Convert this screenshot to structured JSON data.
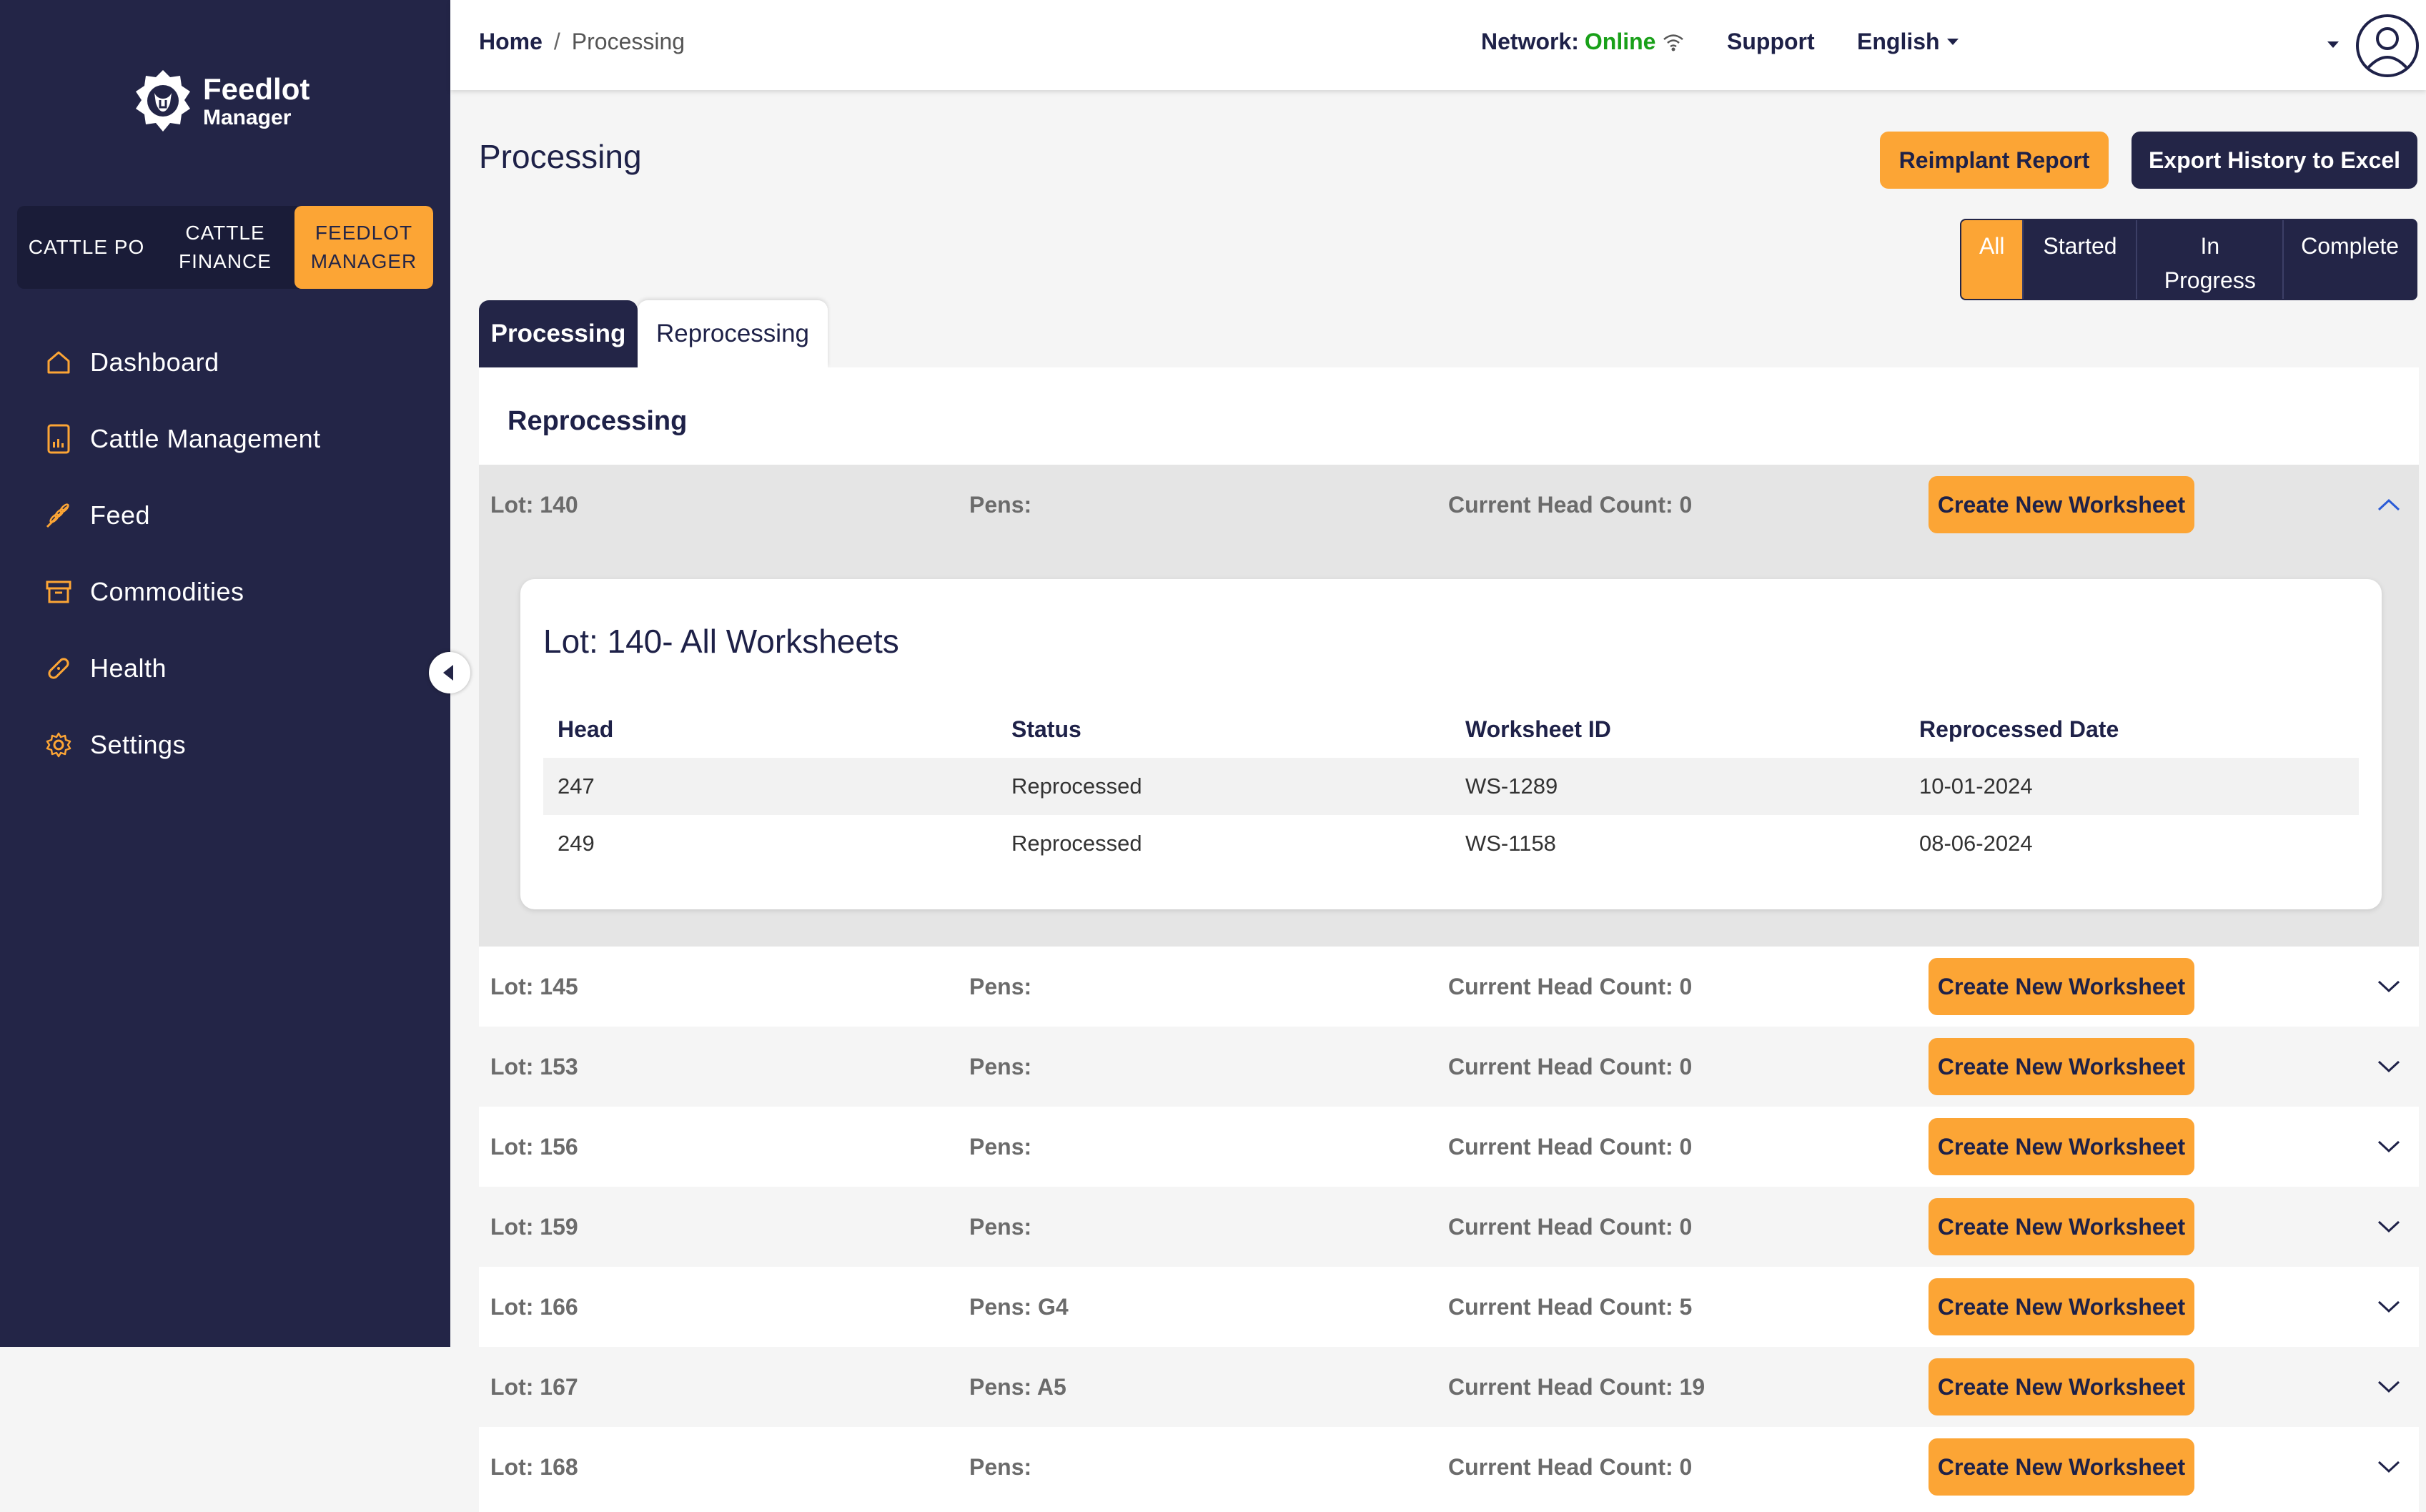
{
  "app": {
    "logo_line1": "Feedlot",
    "logo_line2": "Manager",
    "switcher": [
      {
        "label": "CATTLE PO"
      },
      {
        "label": "CATTLE\nFINANCE"
      },
      {
        "label": "FEEDLOT\nMANAGER"
      }
    ]
  },
  "sidebar": {
    "items": [
      {
        "label": "Dashboard",
        "icon": "home-icon"
      },
      {
        "label": "Cattle Management",
        "icon": "tablet-chart-icon"
      },
      {
        "label": "Feed",
        "icon": "wheat-icon"
      },
      {
        "label": "Commodities",
        "icon": "archive-box-icon"
      },
      {
        "label": "Health",
        "icon": "bandage-icon"
      },
      {
        "label": "Settings",
        "icon": "gear-icon"
      }
    ]
  },
  "topbar": {
    "breadcrumb_home": "Home",
    "breadcrumb_sep": "/",
    "breadcrumb_current": "Processing",
    "network_label": "Network:",
    "network_status": "Online",
    "support": "Support",
    "language": "English"
  },
  "page": {
    "title": "Processing",
    "reimplant_button": "Reimplant Report",
    "export_button": "Export History to Excel",
    "filters": [
      "All",
      "Started",
      "In\nProgress",
      "Complete"
    ],
    "tabs": [
      "Processing",
      "Reprocessing"
    ],
    "panel_title": "Reprocessing"
  },
  "lots": [
    {
      "lot": "Lot: 140",
      "pens": "Pens:",
      "head": "Current Head Count: 0",
      "button": "Create New Worksheet"
    },
    {
      "lot": "Lot: 145",
      "pens": "Pens:",
      "head": "Current Head Count: 0",
      "button": "Create New Worksheet"
    },
    {
      "lot": "Lot: 153",
      "pens": "Pens:",
      "head": "Current Head Count: 0",
      "button": "Create New Worksheet"
    },
    {
      "lot": "Lot: 156",
      "pens": "Pens:",
      "head": "Current Head Count: 0",
      "button": "Create New Worksheet"
    },
    {
      "lot": "Lot: 159",
      "pens": "Pens:",
      "head": "Current Head Count: 0",
      "button": "Create New Worksheet"
    },
    {
      "lot": "Lot: 166",
      "pens": "Pens: G4",
      "head": "Current Head Count: 5",
      "button": "Create New Worksheet"
    },
    {
      "lot": "Lot: 167",
      "pens": "Pens: A5",
      "head": "Current Head Count: 19",
      "button": "Create New Worksheet"
    },
    {
      "lot": "Lot: 168",
      "pens": "Pens:",
      "head": "Current Head Count: 0",
      "button": "Create New Worksheet"
    }
  ],
  "worksheets": {
    "title": "Lot: 140- All Worksheets",
    "headers": [
      "Head",
      "Status",
      "Worksheet ID",
      "Reprocessed Date"
    ],
    "rows": [
      [
        "247",
        "Reprocessed",
        "WS-1289",
        "10-01-2024"
      ],
      [
        "249",
        "Reprocessed",
        "WS-1158",
        "08-06-2024"
      ]
    ]
  },
  "colors": {
    "navy": "#232547",
    "orange": "#fca535",
    "online_green": "#19a019"
  }
}
